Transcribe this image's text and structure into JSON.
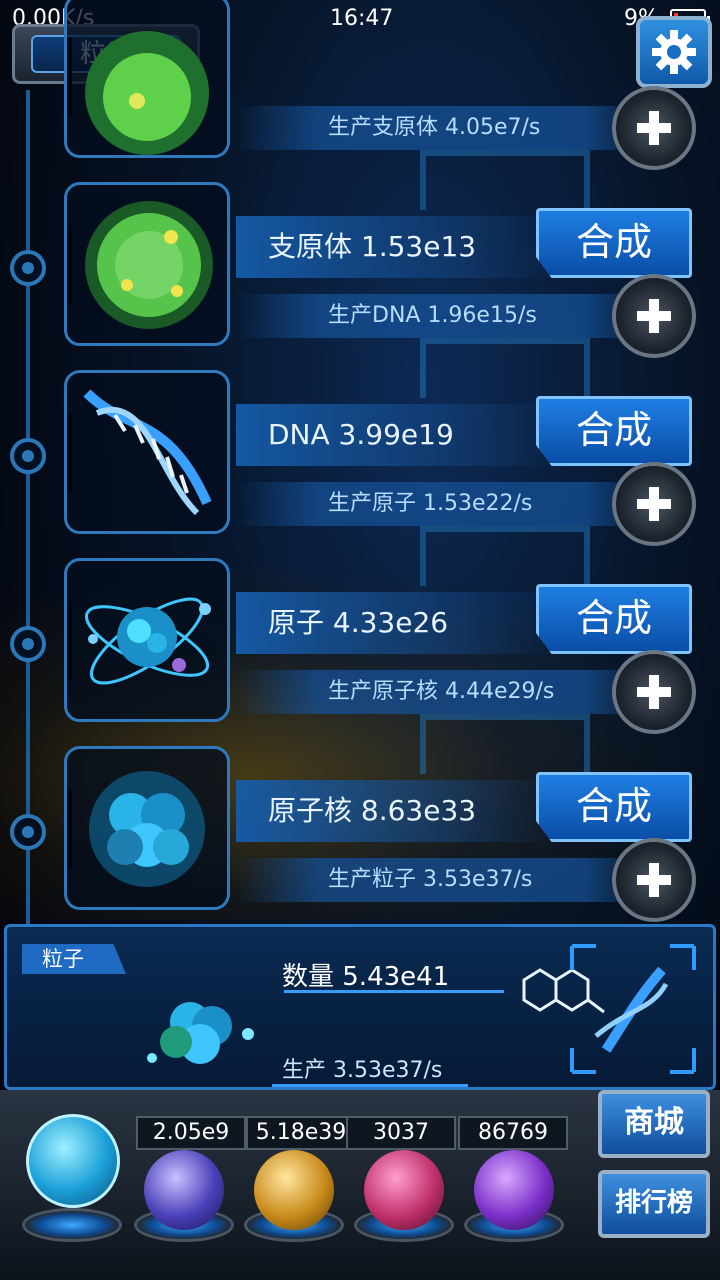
{
  "status_bar": {
    "network": "0.00K/s",
    "time": "16:47",
    "battery": "9%"
  },
  "header": {
    "title": "粒子"
  },
  "rows": [
    {
      "name": "",
      "production": "生产支原体 4.05e7/s",
      "synth_label": ""
    },
    {
      "name": "支原体 1.53e13",
      "production": "生产DNA 1.96e15/s",
      "synth_label": "合成"
    },
    {
      "name": "DNA 3.99e19",
      "production": "生产原子 1.53e22/s",
      "synth_label": "合成"
    },
    {
      "name": "原子 4.33e26",
      "production": "生产原子核 4.44e29/s",
      "synth_label": "合成"
    },
    {
      "name": "原子核 8.63e33",
      "production": "生产粒子 3.53e37/s",
      "synth_label": "合成"
    }
  ],
  "panel": {
    "tag": "粒子",
    "count": "数量 5.43e41",
    "production": "生产 3.53e37/s"
  },
  "dock": {
    "stats": [
      "2.05e9",
      "5.18e39",
      "3037",
      "86769"
    ],
    "shop_label": "商城",
    "rank_label": "排行榜"
  },
  "colors": {
    "accent": "#1f7ee2",
    "frame": "#2f79bd"
  }
}
